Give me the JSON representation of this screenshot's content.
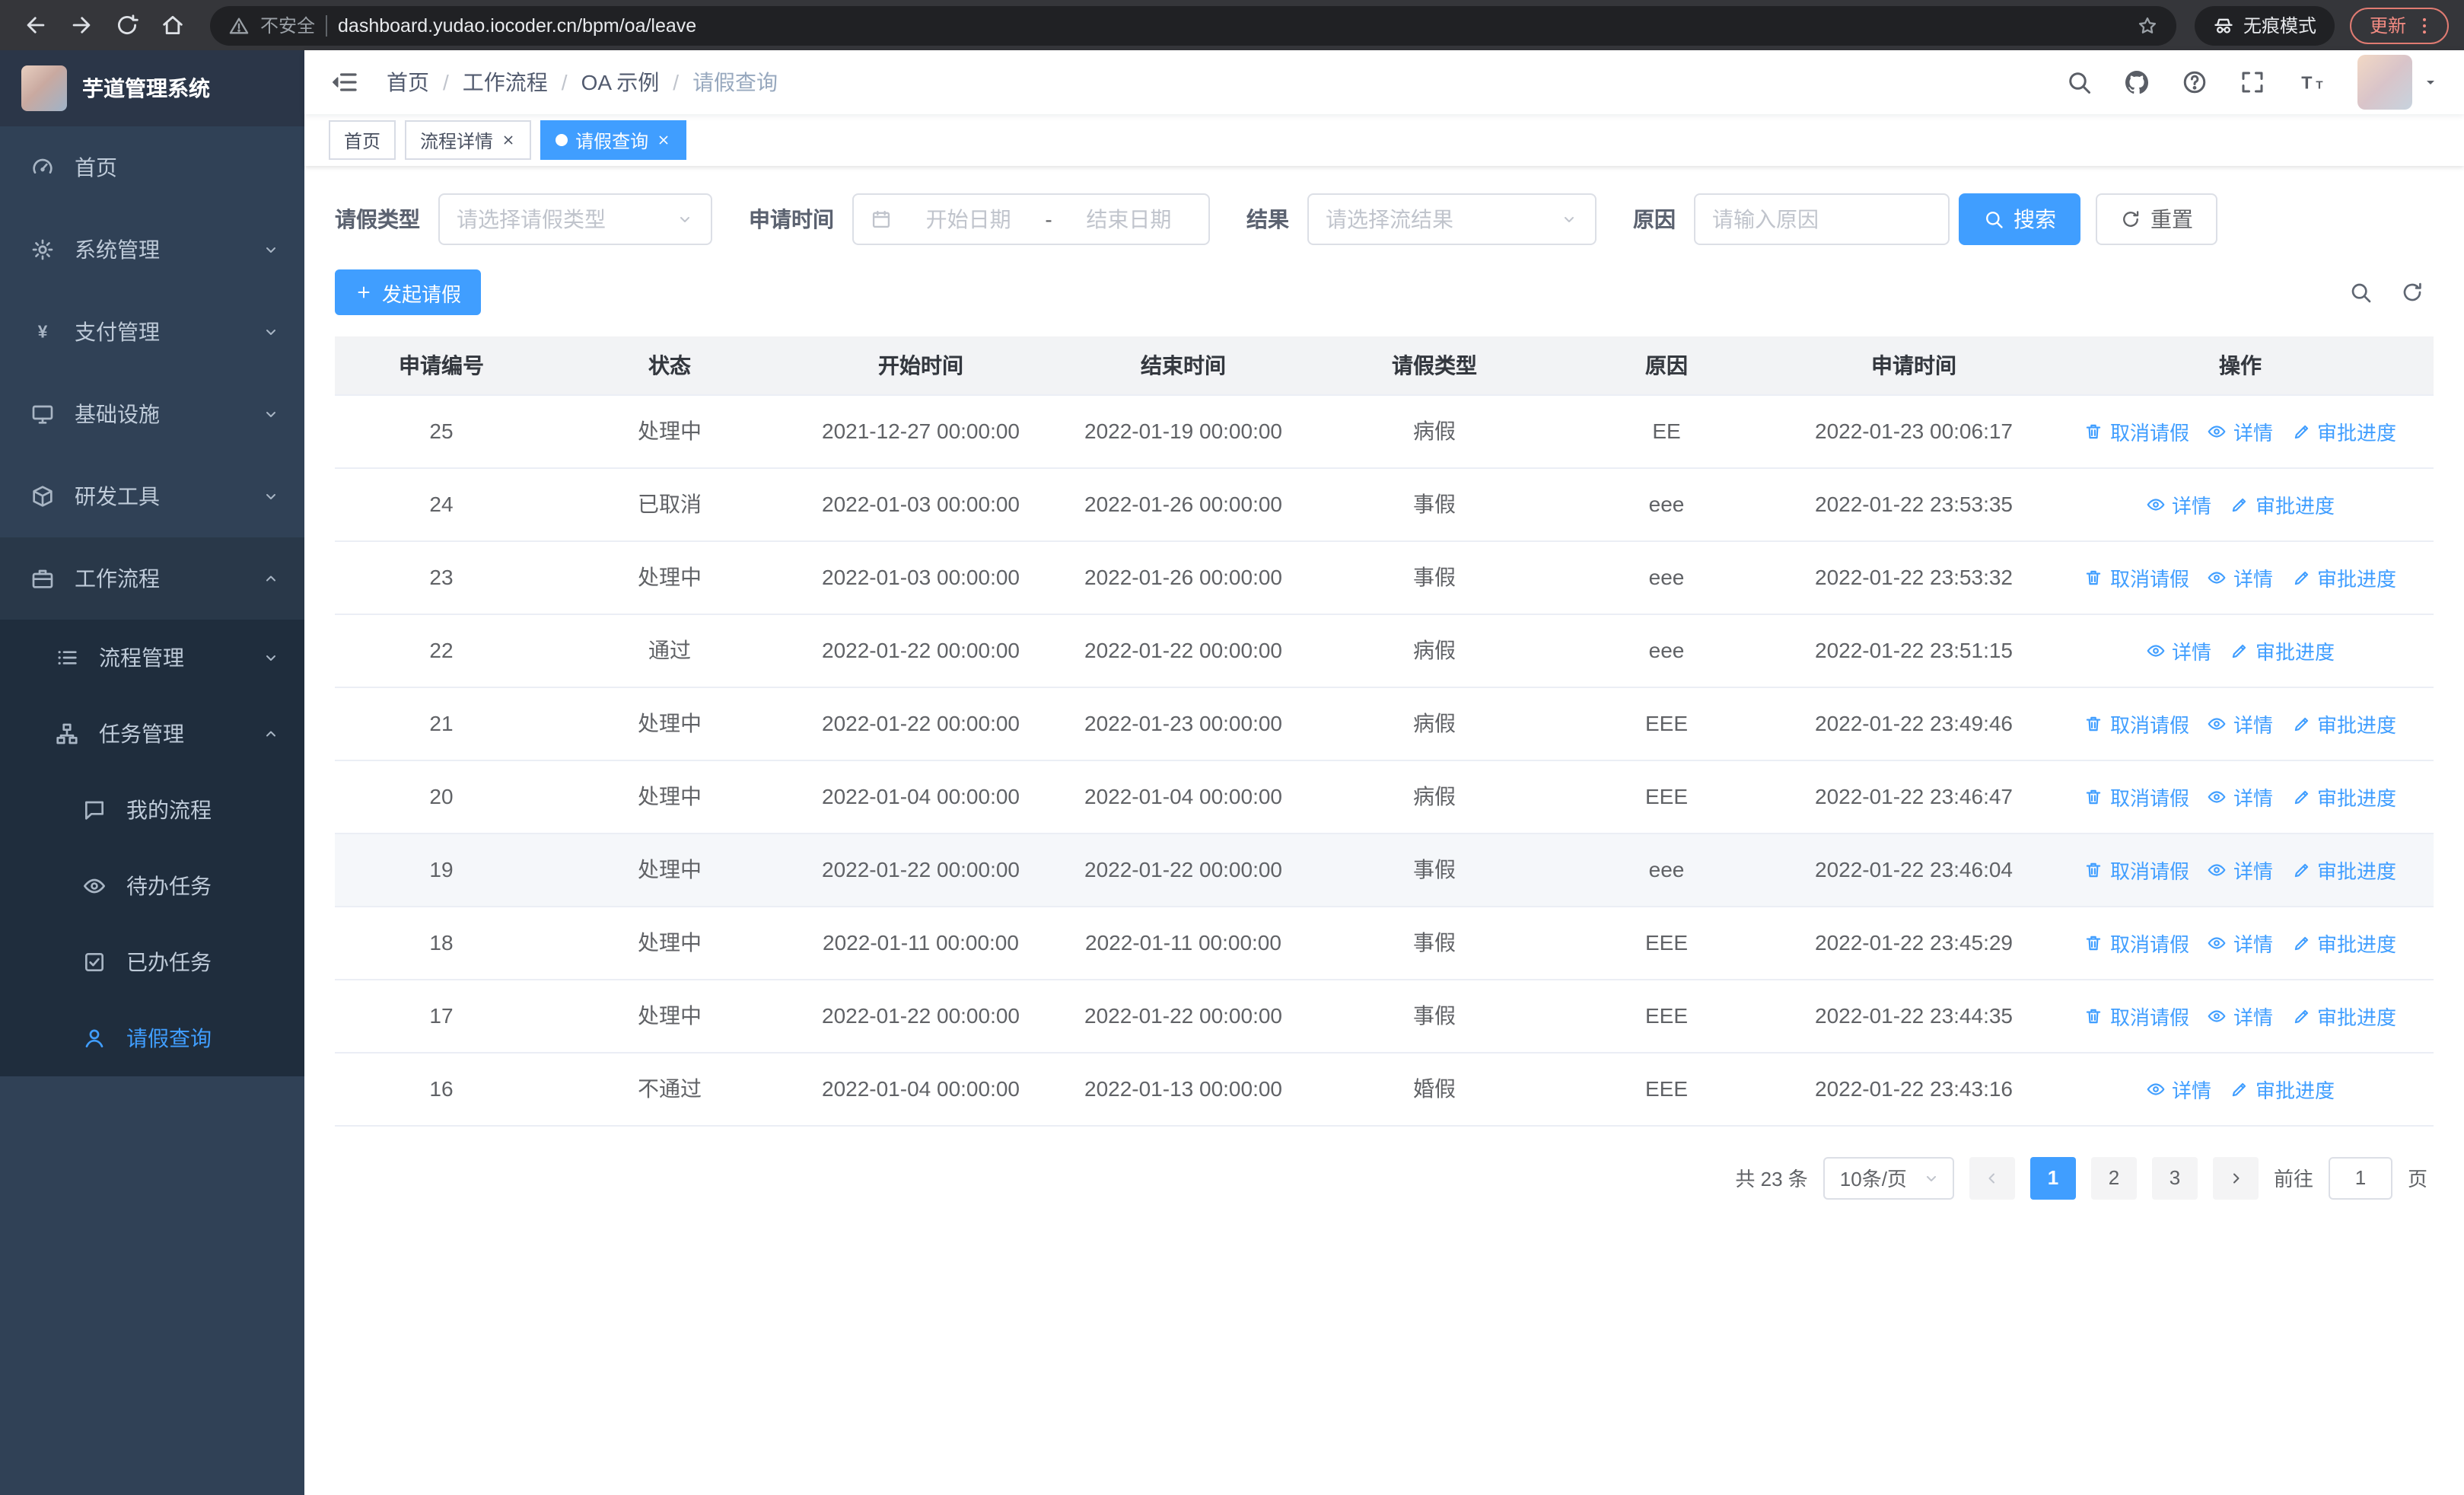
{
  "browser": {
    "security_label": "不安全",
    "url": "dashboard.yudao.iocoder.cn/bpm/oa/leave",
    "incognito_label": "无痕模式",
    "update_button": "更新"
  },
  "sidebar": {
    "title": "芋道管理系统",
    "items": [
      {
        "label": "首页"
      },
      {
        "label": "系统管理"
      },
      {
        "label": "支付管理"
      },
      {
        "label": "基础设施"
      },
      {
        "label": "研发工具"
      },
      {
        "label": "工作流程"
      }
    ],
    "workflow_children": [
      {
        "label": "流程管理"
      },
      {
        "label": "任务管理"
      }
    ],
    "task_children": [
      {
        "label": "我的流程"
      },
      {
        "label": "待办任务"
      },
      {
        "label": "已办任务"
      },
      {
        "label": "请假查询"
      }
    ]
  },
  "header": {
    "breadcrumbs": [
      "首页",
      "工作流程",
      "OA 示例",
      "请假查询"
    ],
    "breadcrumb_separator": "/"
  },
  "tags": [
    {
      "label": "首页"
    },
    {
      "label": "流程详情"
    },
    {
      "label": "请假查询"
    }
  ],
  "filters": {
    "leave_type_label": "请假类型",
    "leave_type_placeholder": "请选择请假类型",
    "apply_time_label": "申请时间",
    "start_date_placeholder": "开始日期",
    "date_separator": "-",
    "end_date_placeholder": "结束日期",
    "result_label": "结果",
    "result_placeholder": "请选择流结果",
    "reason_label": "原因",
    "reason_placeholder": "请输入原因",
    "search_button": "搜索",
    "reset_button": "重置"
  },
  "toolbar": {
    "create_button": "发起请假"
  },
  "table": {
    "columns": [
      "申请编号",
      "状态",
      "开始时间",
      "结束时间",
      "请假类型",
      "原因",
      "申请时间",
      "操作"
    ],
    "action_defs": {
      "cancel": {
        "label": "取消请假"
      },
      "detail": {
        "label": "详情"
      },
      "progress": {
        "label": "审批进度"
      }
    },
    "rows": [
      {
        "id": "25",
        "status": "处理中",
        "start": "2021-12-27 00:00:00",
        "end": "2022-01-19 00:00:00",
        "type": "病假",
        "reason": "EE",
        "apply_time": "2022-01-23 00:06:17",
        "actions": [
          "cancel",
          "detail",
          "progress"
        ],
        "highlight": false
      },
      {
        "id": "24",
        "status": "已取消",
        "start": "2022-01-03 00:00:00",
        "end": "2022-01-26 00:00:00",
        "type": "事假",
        "reason": "eee",
        "apply_time": "2022-01-22 23:53:35",
        "actions": [
          "detail",
          "progress"
        ],
        "highlight": false
      },
      {
        "id": "23",
        "status": "处理中",
        "start": "2022-01-03 00:00:00",
        "end": "2022-01-26 00:00:00",
        "type": "事假",
        "reason": "eee",
        "apply_time": "2022-01-22 23:53:32",
        "actions": [
          "cancel",
          "detail",
          "progress"
        ],
        "highlight": false
      },
      {
        "id": "22",
        "status": "通过",
        "start": "2022-01-22 00:00:00",
        "end": "2022-01-22 00:00:00",
        "type": "病假",
        "reason": "eee",
        "apply_time": "2022-01-22 23:51:15",
        "actions": [
          "detail",
          "progress"
        ],
        "highlight": false
      },
      {
        "id": "21",
        "status": "处理中",
        "start": "2022-01-22 00:00:00",
        "end": "2022-01-23 00:00:00",
        "type": "病假",
        "reason": "EEE",
        "apply_time": "2022-01-22 23:49:46",
        "actions": [
          "cancel",
          "detail",
          "progress"
        ],
        "highlight": false
      },
      {
        "id": "20",
        "status": "处理中",
        "start": "2022-01-04 00:00:00",
        "end": "2022-01-04 00:00:00",
        "type": "病假",
        "reason": "EEE",
        "apply_time": "2022-01-22 23:46:47",
        "actions": [
          "cancel",
          "detail",
          "progress"
        ],
        "highlight": false
      },
      {
        "id": "19",
        "status": "处理中",
        "start": "2022-01-22 00:00:00",
        "end": "2022-01-22 00:00:00",
        "type": "事假",
        "reason": "eee",
        "apply_time": "2022-01-22 23:46:04",
        "actions": [
          "cancel",
          "detail",
          "progress"
        ],
        "highlight": true
      },
      {
        "id": "18",
        "status": "处理中",
        "start": "2022-01-11 00:00:00",
        "end": "2022-01-11 00:00:00",
        "type": "事假",
        "reason": "EEE",
        "apply_time": "2022-01-22 23:45:29",
        "actions": [
          "cancel",
          "detail",
          "progress"
        ],
        "highlight": false
      },
      {
        "id": "17",
        "status": "处理中",
        "start": "2022-01-22 00:00:00",
        "end": "2022-01-22 00:00:00",
        "type": "事假",
        "reason": "EEE",
        "apply_time": "2022-01-22 23:44:35",
        "actions": [
          "cancel",
          "detail",
          "progress"
        ],
        "highlight": false
      },
      {
        "id": "16",
        "status": "不通过",
        "start": "2022-01-04 00:00:00",
        "end": "2022-01-13 00:00:00",
        "type": "婚假",
        "reason": "EEE",
        "apply_time": "2022-01-22 23:43:16",
        "actions": [
          "detail",
          "progress"
        ],
        "highlight": false
      }
    ]
  },
  "pagination": {
    "total": "共 23 条",
    "page_size": "10条/页",
    "pages": [
      "1",
      "2",
      "3"
    ],
    "active_page": "1",
    "goto_label": "前往",
    "goto_value": "1",
    "page_unit": "页"
  },
  "colors": {
    "primary": "#409eff",
    "sidebar_bg": "#304156",
    "submenu_bg": "#1f2d3d"
  }
}
